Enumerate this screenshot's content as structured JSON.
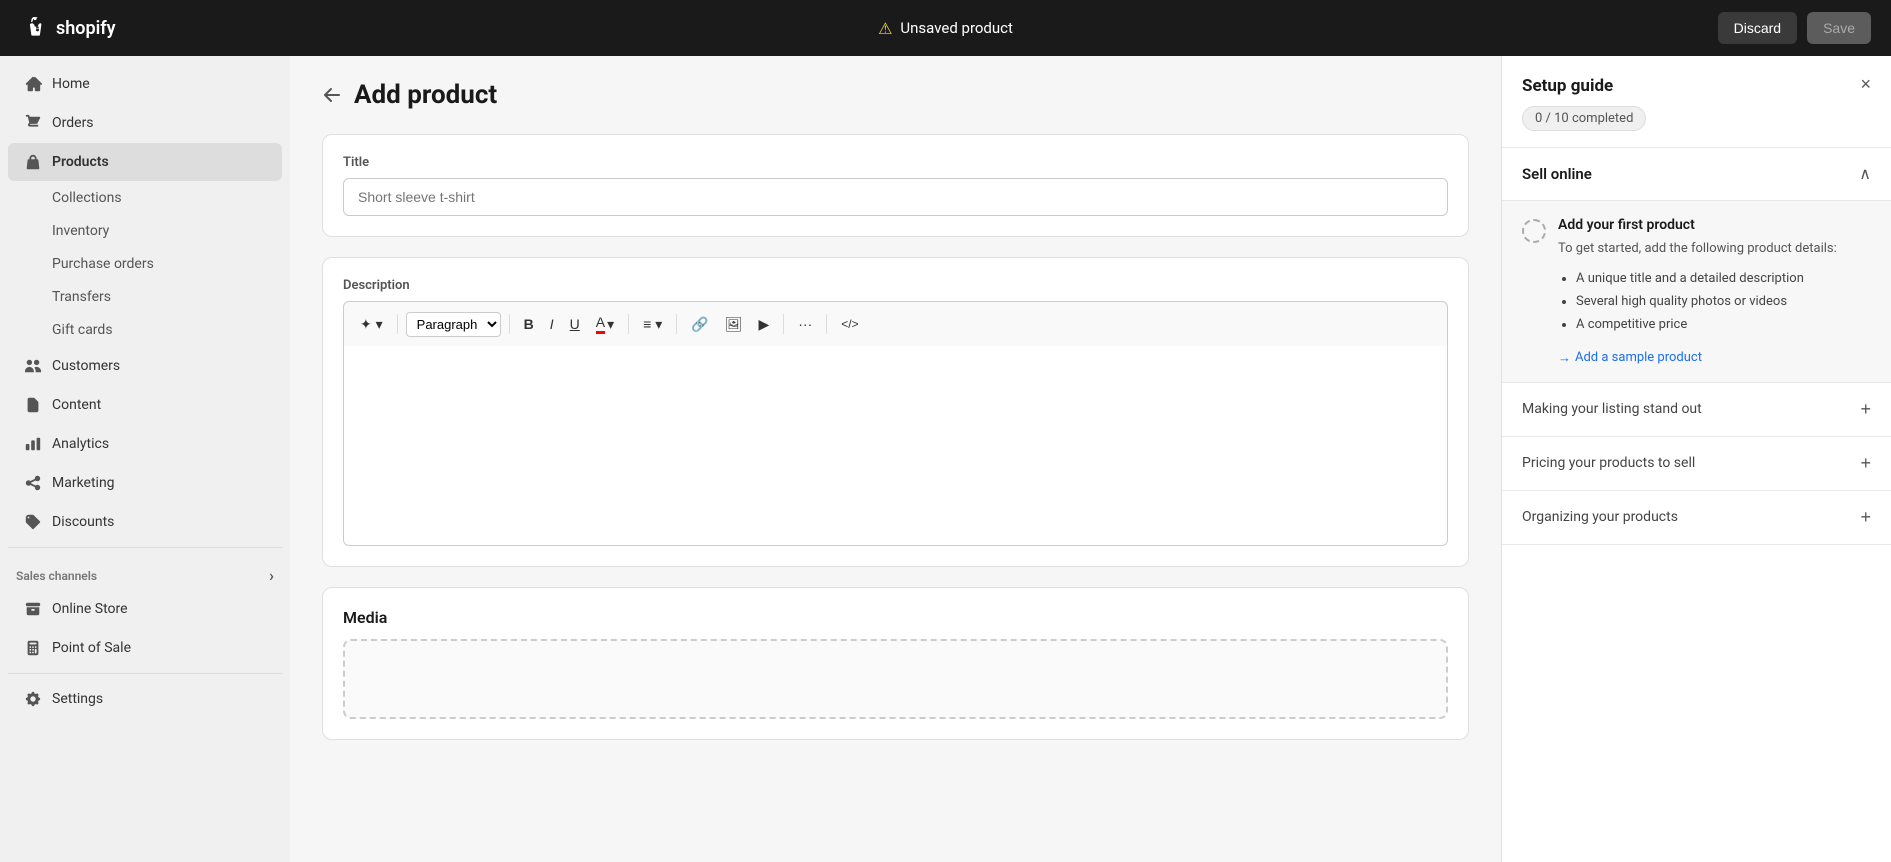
{
  "topbar": {
    "logo_text": "shopify",
    "warning_icon": "⚠",
    "title": "Unsaved product",
    "discard_label": "Discard",
    "save_label": "Save"
  },
  "sidebar": {
    "items": [
      {
        "id": "home",
        "label": "Home",
        "icon": "home"
      },
      {
        "id": "orders",
        "label": "Orders",
        "icon": "orders"
      },
      {
        "id": "products",
        "label": "Products",
        "icon": "products",
        "active": true
      },
      {
        "id": "customers",
        "label": "Customers",
        "icon": "customers"
      },
      {
        "id": "content",
        "label": "Content",
        "icon": "content"
      },
      {
        "id": "analytics",
        "label": "Analytics",
        "icon": "analytics"
      },
      {
        "id": "marketing",
        "label": "Marketing",
        "icon": "marketing"
      },
      {
        "id": "discounts",
        "label": "Discounts",
        "icon": "discounts"
      }
    ],
    "sub_items": [
      {
        "id": "collections",
        "label": "Collections"
      },
      {
        "id": "inventory",
        "label": "Inventory"
      },
      {
        "id": "purchase_orders",
        "label": "Purchase orders"
      },
      {
        "id": "transfers",
        "label": "Transfers"
      },
      {
        "id": "gift_cards",
        "label": "Gift cards"
      }
    ],
    "sales_channels_label": "Sales channels",
    "sales_channels": [
      {
        "id": "online_store",
        "label": "Online Store",
        "icon": "store"
      },
      {
        "id": "pos",
        "label": "Point of Sale",
        "icon": "pos"
      }
    ],
    "settings_label": "Settings",
    "settings_icon": "gear"
  },
  "page": {
    "back_label": "←",
    "title": "Add product"
  },
  "product_form": {
    "title_label": "Title",
    "title_placeholder": "Short sleeve t-shirt",
    "description_label": "Description",
    "toolbar": {
      "paragraph_label": "Paragraph",
      "bold": "B",
      "italic": "I",
      "underline": "U",
      "more": "···",
      "code": "</>",
      "paragraph_dropdown": "▾",
      "color_dropdown": "A▾",
      "align_dropdown": "≡▾"
    },
    "media_label": "Media"
  },
  "setup_guide": {
    "title": "Setup guide",
    "close_icon": "×",
    "progress": "0 / 10 completed",
    "section_title": "Sell online",
    "chevron_icon": "∧",
    "active_step": {
      "title": "Add your first product",
      "description": "To get started, add the following product details:",
      "checklist": [
        "A unique title and a detailed description",
        "Several high quality photos or videos",
        "A competitive price"
      ],
      "link_text": "Add a sample product",
      "link_arrow": "→"
    },
    "collapsed_steps": [
      {
        "id": "listing",
        "label": "Making your listing stand out",
        "icon": "+"
      },
      {
        "id": "pricing",
        "label": "Pricing your products to sell",
        "icon": "+"
      },
      {
        "id": "organizing",
        "label": "Organizing your products",
        "icon": "+"
      }
    ]
  }
}
